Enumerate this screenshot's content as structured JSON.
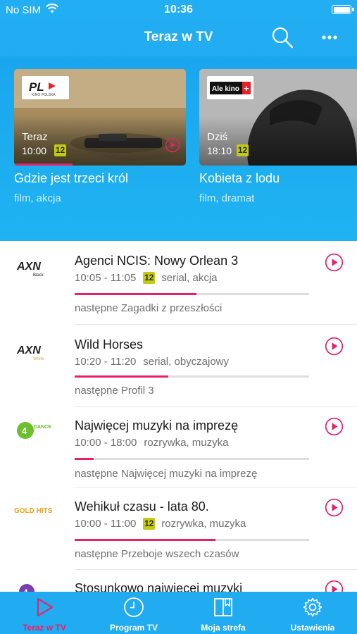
{
  "status_bar": {
    "carrier": "No SIM",
    "time": "10:36"
  },
  "header": {
    "title": "Teraz w TV",
    "search_icon": "search-icon",
    "more_icon": "more-icon"
  },
  "featured": [
    {
      "channel_logo_text": "PL",
      "channel_logo_sub": "KINO POLSKA",
      "when": "Teraz",
      "hour": "10:00",
      "age": "12",
      "title": "Gdzie jest trzeci król",
      "genre": "film, akcja",
      "progress": 0.34
    },
    {
      "channel_logo_text": "Ale kino",
      "channel_logo_plus": "+",
      "when": "Dziś",
      "hour": "18:10",
      "age": "12",
      "title": "Kobieta z lodu",
      "genre": "film, dramat",
      "progress": 0
    }
  ],
  "programs": [
    {
      "channel": "AXN",
      "channel_sub": "Black",
      "title": "Agenci NCIS: Nowy Orlean 3",
      "time": "10:05 - 11:05",
      "age": "12",
      "genre": "serial, akcja",
      "progress": 0.52,
      "next": "następne Zagadki z przeszłości"
    },
    {
      "channel": "AXN",
      "channel_sub": "White",
      "title": "Wild Horses",
      "time": "10:20 - 11:20",
      "age": "",
      "genre": "serial, obyczajowy",
      "progress": 0.4,
      "next": "następne Profil 3"
    },
    {
      "channel": "4FUN",
      "channel_sub": "DANCE",
      "title": "Najwięcej muzyki na imprezę",
      "time": "10:00 - 18:00",
      "age": "",
      "genre": "rozrywka, muzyka",
      "progress": 0.08,
      "next": "następne Najwięcej muzyki na imprezę"
    },
    {
      "channel": "GOLD HITS",
      "channel_sub": "",
      "title": "Wehikuł czasu - lata 80.",
      "time": "10:00 - 11:00",
      "age": "12",
      "genre": "rozrywka, muzyka",
      "progress": 0.6,
      "next": "następne Przeboje wszech czasów"
    },
    {
      "channel": "4FUN TV",
      "channel_sub": "",
      "title": "Stosunkowo najwięcej muzyki",
      "time": "",
      "age": "",
      "genre": "",
      "progress": 0,
      "next": ""
    }
  ],
  "tabs": [
    {
      "label": "Teraz w TV",
      "icon": "play-icon",
      "active": true
    },
    {
      "label": "Program TV",
      "icon": "clock-icon",
      "active": false
    },
    {
      "label": "Moja strefa",
      "icon": "book-icon",
      "active": false
    },
    {
      "label": "Ustawienia",
      "icon": "gear-icon",
      "active": false
    }
  ],
  "colors": {
    "brand_blue": "#21abf0",
    "accent_pink": "#e8206a",
    "age_badge": "#c4c914"
  }
}
